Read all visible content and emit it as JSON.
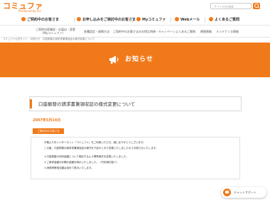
{
  "header": {
    "logo": "コミュファ",
    "logo_sub": "Produced by ctc",
    "search_placeholder": "サイト内を検索"
  },
  "global_nav": [
    "ご契約中のお客さま",
    "お申し込みをご検討中のお客さま",
    "Myコミュファ",
    "Webメール",
    "よくあるご質問"
  ],
  "sub_nav": {
    "item1_line1": "ご契約内容確認・お届出・変更",
    "item1_line2": "(Myコミュファ)",
    "item2": "各種設定・故障方法",
    "item3": "ご契約中のお客さまのお得な特典・キャンペーン",
    "item4": "よくあるご質問",
    "item5": "障害情報",
    "item6": "メンテナンス情報"
  },
  "breadcrumb": "コミュファ公式サイト　お知らせ　口座振替の請求書兼領収証の様式変更について",
  "banner": {
    "title": "お知らせ"
  },
  "article": {
    "title": "口座振替の請求書兼領収証の様式変更について",
    "date": "2007年5月14日",
    "tag": "ご契約中のお客さま",
    "paragraphs": [
      "平素より光インターネット「コミュファ」をご利用いただき、誠にありがとうございます。",
      "この度、口座振替の請求書兼領収証の様式を下記のとおり変更いたしましたのでお知らせいたします。",
      "＊口座振替の内訳金額について明記するよう標準様式を変更いたしました。",
      "＊ご請求金額の計欄の金額を明示いたしました。（円未満切捨て）",
      "＊消費税等相当額は含めて表示いたします。"
    ]
  },
  "chat": {
    "label": "チャットサポート"
  },
  "colors": {
    "accent": "#f07a1a"
  }
}
